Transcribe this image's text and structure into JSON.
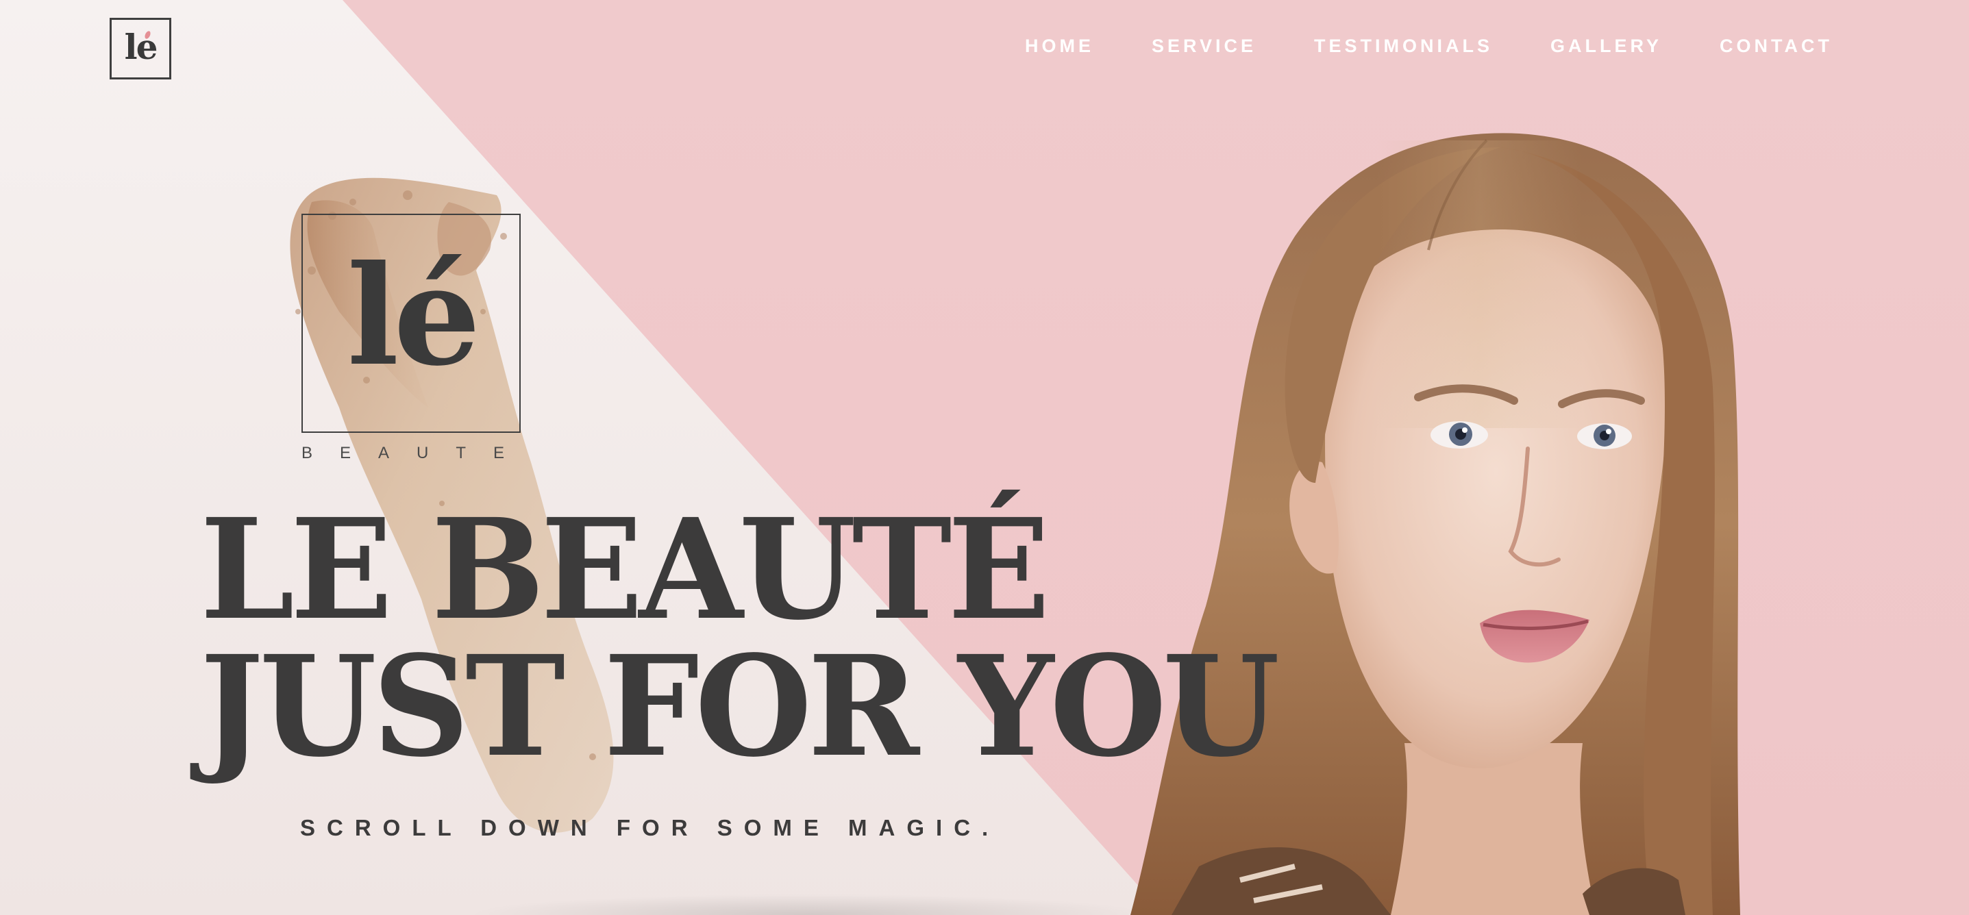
{
  "brand": {
    "logo_text": "le",
    "mark_text": "lé",
    "mark_subtitle": "BEAUTE"
  },
  "nav": {
    "items": [
      {
        "label": "HOME"
      },
      {
        "label": "SERVICE"
      },
      {
        "label": "TESTIMONIALS"
      },
      {
        "label": "GALLERY"
      },
      {
        "label": "CONTACT"
      }
    ]
  },
  "hero": {
    "headline_line1": "LE BEAUTÉ",
    "headline_line2": "JUST FOR YOU",
    "tagline": "SCROLL DOWN FOR SOME MAGIC."
  },
  "colors": {
    "pink_panel": "#efc6c8",
    "text_dark": "#3c3b3b",
    "nav_text": "#ffffff",
    "accent_pink": "#e58f95"
  }
}
